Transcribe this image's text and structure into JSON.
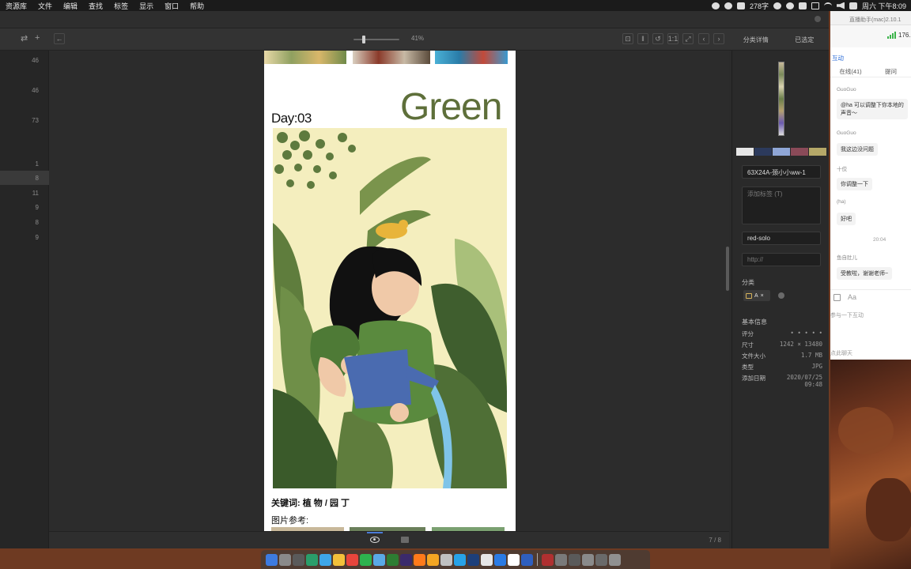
{
  "menubar": {
    "items": [
      "资源库",
      "文件",
      "编辑",
      "查找",
      "标签",
      "显示",
      "窗口",
      "帮助"
    ],
    "status_text": "278字",
    "clock": "周六 下午8:09"
  },
  "toolbar": {
    "zoom": "41%",
    "zoom_fraction": 0.2
  },
  "panel_tabs": {
    "details": "分类详情",
    "selected": "已选定"
  },
  "left_counts": [
    "46",
    "46",
    "73",
    "1",
    "8",
    "11",
    "9",
    "8",
    "9"
  ],
  "page": {
    "day_title": "Day:03",
    "headline": "Green",
    "keywords": "关键词: 植 物 / 园 丁",
    "references_label": "图片参考:"
  },
  "footer": {
    "page_counter": "7 / 8"
  },
  "inspector": {
    "swatches": [
      "#e6e6e6",
      "#2c3a5c",
      "#8fa6d6",
      "#8a4a58",
      "#b5a868"
    ],
    "filename": "63X24A-颈小小ww-1",
    "tags_placeholder": "添加标签 (T)",
    "author": "red-solo",
    "url_placeholder": "http://",
    "category_label": "分类",
    "category_chip": "A",
    "basic_info_label": "基本信息",
    "info": [
      {
        "label": "评分",
        "value": "• • • • •"
      },
      {
        "label": "尺寸",
        "value": "1242 × 13480"
      },
      {
        "label": "文件大小",
        "value": "1.7 MB"
      },
      {
        "label": "类型",
        "value": "JPG"
      },
      {
        "label": "添加日期",
        "value": "2020/07/25 09:48"
      }
    ]
  },
  "chat": {
    "window_title": "直播助手(mac)2.10.1",
    "signal_text": "176.",
    "section_title": "互动",
    "tabs": [
      "在线(41)",
      "提问"
    ],
    "messages": [
      {
        "name": "GuoGuo",
        "text": "@ha 可以调整下你本地的声音～"
      },
      {
        "name": "GuoGuo",
        "text": "我这边没问题"
      },
      {
        "name": "十佼",
        "text": "你调整一下"
      },
      {
        "name": "(ha)",
        "text": "好吧"
      },
      {
        "name": "鱼自肚儿",
        "text": "受教啦，谢谢老师~"
      }
    ],
    "time": "20:04",
    "input_placeholder": "参与一下互动",
    "footer": "点此聊天"
  },
  "dock": {
    "colors": [
      "#3d7be0",
      "#8a8a8a",
      "#5a5a5a",
      "#2a9d6a",
      "#3ea6e8",
      "#f2c03a",
      "#e8453c",
      "#2eb24e",
      "#5aa9e6",
      "#2e7d32",
      "#3b2a6b",
      "#ff7a1a",
      "#f5a623",
      "#c0c0c0",
      "#27a2e8",
      "#1d3f7a",
      "#e6e6e6",
      "#2a7be4",
      "#ffffff",
      "#2f5fbf",
      "#b03030",
      "#7a7a7a",
      "#5a5a5a",
      "#8a8a8a",
      "#6a6a6a",
      "#909090"
    ]
  }
}
